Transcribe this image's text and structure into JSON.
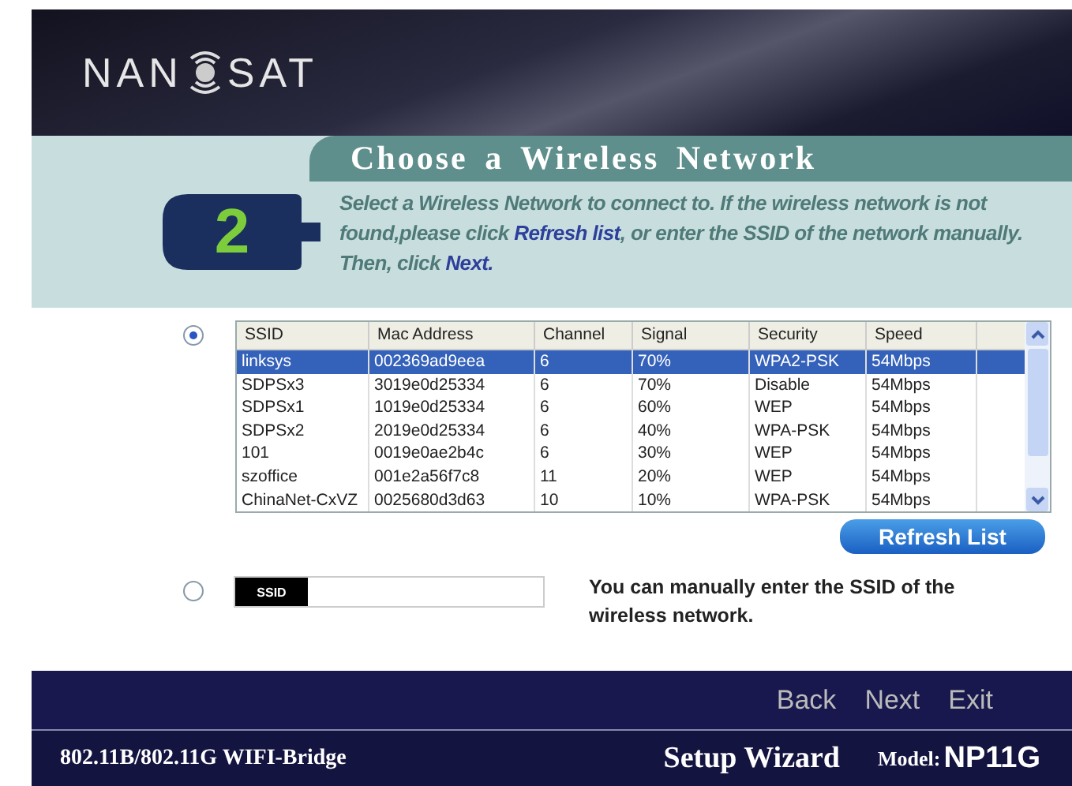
{
  "header": {
    "logo_left": "NAN",
    "logo_right": "SAT"
  },
  "step": {
    "title": "Choose a Wireless Network",
    "number": "2",
    "description": [
      {
        "kind": "text",
        "text": "Select a Wireless Network to connect to. If the wireless network is not found,please click "
      },
      {
        "kind": "link",
        "text": "Refresh list"
      },
      {
        "kind": "text",
        "text": ", or enter the SSID of the network manually. Then, click "
      },
      {
        "kind": "link",
        "text": "Next."
      }
    ]
  },
  "list_option": {
    "selected": true
  },
  "table": {
    "columns": [
      "SSID",
      "Mac Address",
      "Channel",
      "Signal",
      "Security",
      "Speed"
    ],
    "rows": [
      {
        "cells": [
          "linksys",
          "002369ad9eea",
          "6",
          "70%",
          "WPA2-PSK",
          "54Mbps"
        ],
        "selected": true
      },
      {
        "cells": [
          "SDPSx3",
          "3019e0d25334",
          "6",
          "70%",
          "Disable",
          "54Mbps"
        ],
        "selected": false
      },
      {
        "cells": [
          "SDPSx1",
          "1019e0d25334",
          "6",
          "60%",
          "WEP",
          "54Mbps"
        ],
        "selected": false
      },
      {
        "cells": [
          "SDPSx2",
          "2019e0d25334",
          "6",
          "40%",
          "WPA-PSK",
          "54Mbps"
        ],
        "selected": false
      },
      {
        "cells": [
          "101",
          "0019e0ae2b4c",
          "6",
          "30%",
          "WEP",
          "54Mbps"
        ],
        "selected": false
      },
      {
        "cells": [
          "szoffice",
          "001e2a56f7c8",
          "11",
          "20%",
          "WEP",
          "54Mbps"
        ],
        "selected": false
      },
      {
        "cells": [
          "ChinaNet-CxVZ",
          "0025680d3d63",
          "10",
          "10%",
          "WPA-PSK",
          "54Mbps"
        ],
        "selected": false
      }
    ]
  },
  "refresh_button": "Refresh List",
  "manual_option": {
    "selected": false,
    "field_label": "SSID",
    "hint": "You can manually enter the SSID of the wireless network."
  },
  "nav": [
    "Back",
    "Next",
    "Exit"
  ],
  "footer": {
    "product": "802.11B/802.11G  WIFI-Bridge",
    "wizard": "Setup Wizard",
    "model_label": "Model:",
    "model": "NP11G"
  }
}
